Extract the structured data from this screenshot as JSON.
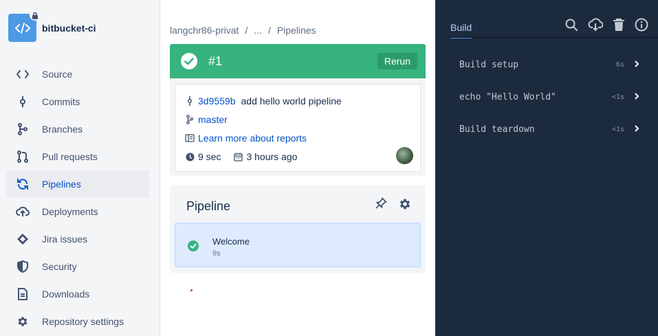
{
  "sidebar": {
    "repo_name": "bitbucket-ci",
    "items": [
      {
        "label": "Source",
        "icon": "code-icon",
        "active": false
      },
      {
        "label": "Commits",
        "icon": "commit-icon",
        "active": false
      },
      {
        "label": "Branches",
        "icon": "branch-icon",
        "active": false
      },
      {
        "label": "Pull requests",
        "icon": "pull-request-icon",
        "active": false
      },
      {
        "label": "Pipelines",
        "icon": "pipelines-icon",
        "active": true
      },
      {
        "label": "Deployments",
        "icon": "cloud-upload-icon",
        "active": false
      },
      {
        "label": "Jira issues",
        "icon": "jira-icon",
        "active": false
      },
      {
        "label": "Security",
        "icon": "shield-icon",
        "active": false
      },
      {
        "label": "Downloads",
        "icon": "file-icon",
        "active": false
      },
      {
        "label": "Repository settings",
        "icon": "gear-icon",
        "active": false
      }
    ]
  },
  "breadcrumb": {
    "owner": "langchr86-privat",
    "ellipsis": "...",
    "current": "Pipelines",
    "separator": "/"
  },
  "build": {
    "number": "#1",
    "rerun_label": "Rerun",
    "commit_hash": "3d9559b",
    "commit_message": "add hello world pipeline",
    "branch": "master",
    "reports_link": "Learn more about reports",
    "duration": "9 sec",
    "time_ago": "3 hours ago",
    "status_color": "#36b37e"
  },
  "pipeline": {
    "title": "Pipeline",
    "step_name": "Welcome",
    "step_duration": "9s"
  },
  "log": {
    "tab": "Build",
    "steps": [
      {
        "name": "Build setup",
        "time": "6s"
      },
      {
        "name": "echo \"Hello World\"",
        "time": "<1s"
      },
      {
        "name": "Build teardown",
        "time": "<1s"
      }
    ]
  }
}
